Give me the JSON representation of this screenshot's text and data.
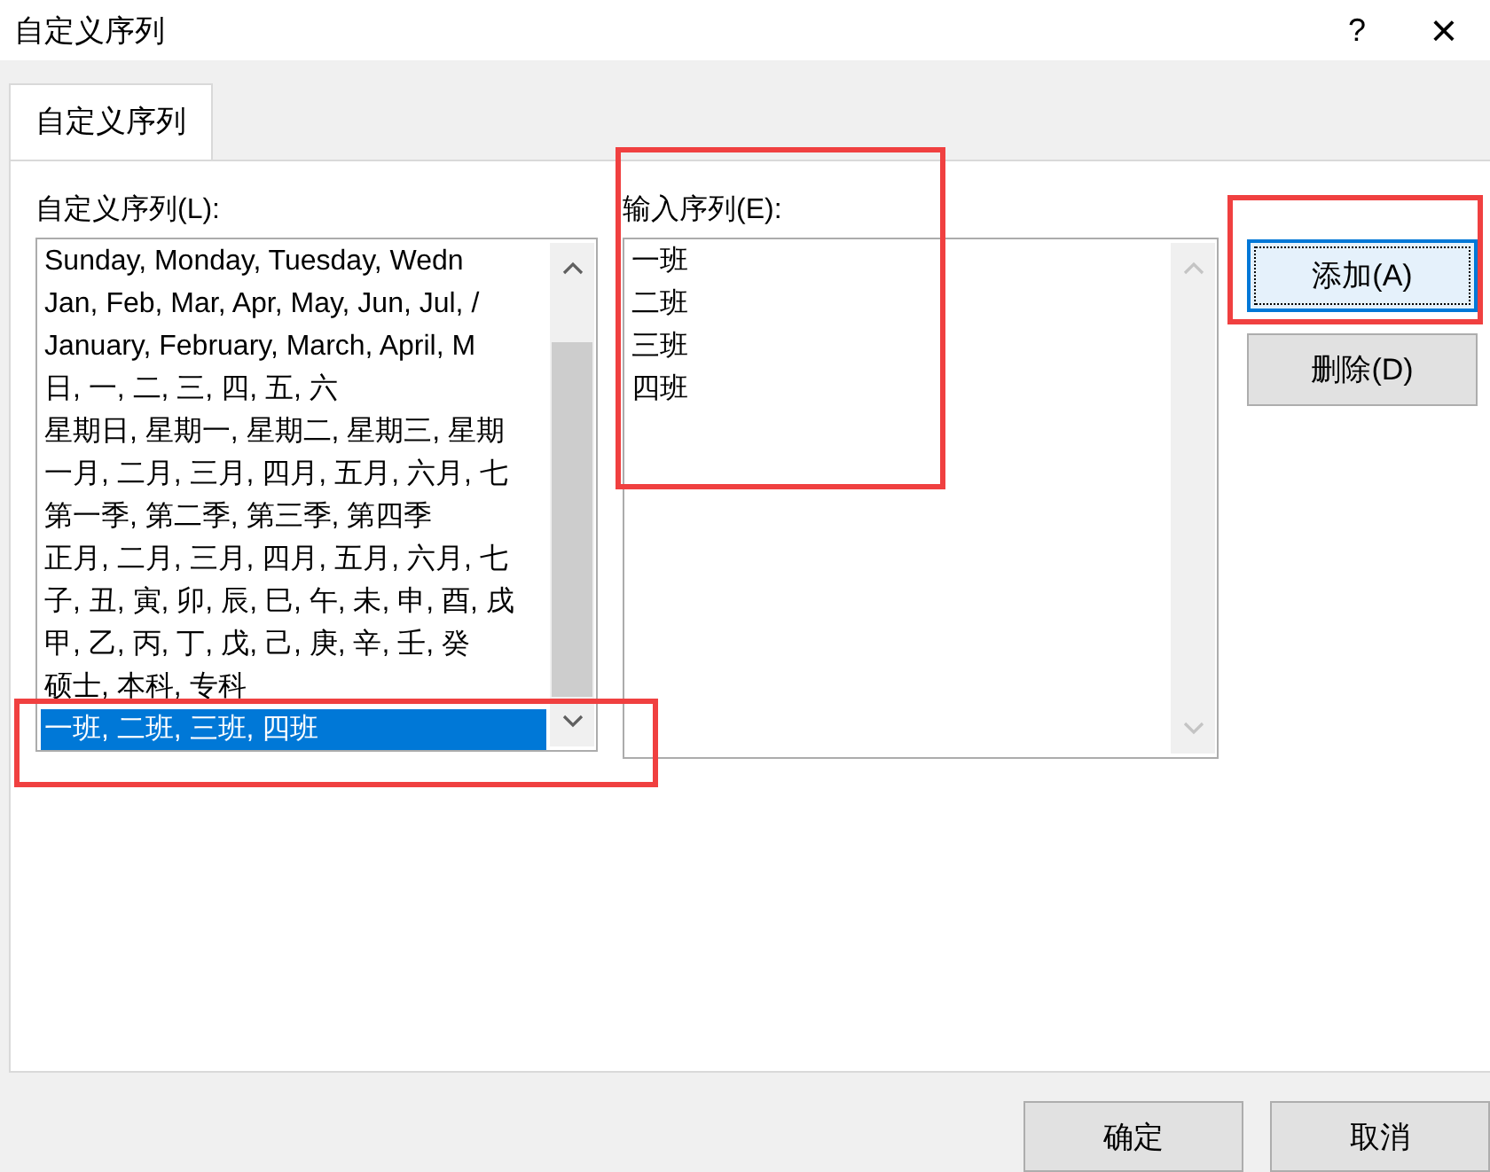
{
  "window": {
    "title": "自定义序列",
    "help": "?",
    "close": "×"
  },
  "tabs": [
    {
      "label": "自定义序列",
      "selected": true
    }
  ],
  "custom_lists": {
    "label": "自定义序列(L):",
    "items": [
      {
        "text": "Sunday, Monday, Tuesday, Wedn",
        "selected": false
      },
      {
        "text": "Jan, Feb, Mar, Apr, May, Jun, Jul, /",
        "selected": false
      },
      {
        "text": "January, February, March, April, M",
        "selected": false
      },
      {
        "text": "日, 一, 二, 三, 四, 五, 六",
        "selected": false
      },
      {
        "text": "星期日, 星期一, 星期二, 星期三, 星期",
        "selected": false
      },
      {
        "text": "一月, 二月, 三月, 四月, 五月, 六月, 七",
        "selected": false
      },
      {
        "text": "第一季, 第二季, 第三季, 第四季",
        "selected": false
      },
      {
        "text": "正月, 二月, 三月, 四月, 五月, 六月, 七",
        "selected": false
      },
      {
        "text": "子, 丑, 寅, 卯, 辰, 巳, 午, 未, 申, 酉, 戌",
        "selected": false
      },
      {
        "text": "甲, 乙, 丙, 丁, 戊, 己, 庚, 辛, 壬, 癸",
        "selected": false
      },
      {
        "text": "硕士, 本科, 专科",
        "selected": false
      },
      {
        "text": "一班, 二班, 三班, 四班",
        "selected": true
      }
    ]
  },
  "list_entries": {
    "label": "输入序列(E):",
    "lines": [
      "一班",
      "二班",
      "三班",
      "四班"
    ]
  },
  "side_buttons": [
    {
      "label": "添加(A)",
      "focused": true
    },
    {
      "label": "删除(D)",
      "focused": false
    }
  ],
  "footer_buttons": [
    "确定",
    "取消"
  ]
}
